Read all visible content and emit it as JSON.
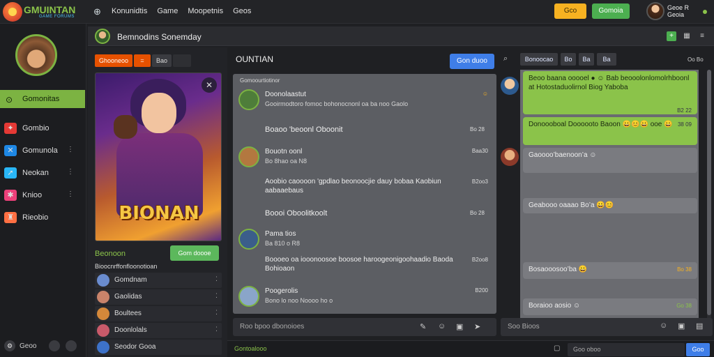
{
  "app": {
    "brand": "GMUINTAN",
    "brand_sub": "GAME FORUMS"
  },
  "topbar": {
    "nav": [
      "Konunidtis",
      "Game",
      "Moopetnis",
      "Geos"
    ],
    "yellow_btn": "Gco",
    "green_btn": "Gomoia",
    "user_line1": "Geoe R",
    "user_line2": "Geoia"
  },
  "sidebar": {
    "active": "Gomonitas",
    "items": [
      {
        "label": "Gombio",
        "icon": "gamepad-icon",
        "color": "#e53935",
        "more": ""
      },
      {
        "label": "Gomunola",
        "icon": "game-icon",
        "color": "#1e88e5",
        "more": "⋮"
      },
      {
        "label": "Neokan",
        "icon": "arrow-icon",
        "color": "#29b6f6",
        "more": "⋮"
      },
      {
        "label": "Knioo",
        "icon": "puzzle-icon",
        "color": "#ec407a",
        "more": "⋮"
      },
      {
        "label": "Rieobio",
        "icon": "trophy-icon",
        "color": "#ff7043",
        "more": ""
      }
    ],
    "bottom_label": "Geoo"
  },
  "channel": {
    "title": "Bemnodins Sonemday"
  },
  "left_pane": {
    "tags": [
      "Ghooneoo",
      "=",
      "Bao"
    ],
    "hero_title": "BIONAN",
    "section_title": "Beonoon",
    "section_button": "Gom doooe",
    "subtitle": "Bioocnrffonfloonotioan",
    "list": [
      {
        "name": "Gomdnam",
        "color": "#6a8ccf"
      },
      {
        "name": "Gaolidas",
        "color": "#c9836a"
      },
      {
        "name": "Boultees",
        "color": "#d4883a"
      },
      {
        "name": "Doonlolals",
        "color": "#c95a6a"
      },
      {
        "name": "Seodor Gooa",
        "color": "#3d72c9"
      }
    ]
  },
  "center": {
    "title": "OUNTIAN",
    "button": "Gon duoo",
    "feed_head": "Gomoourtiotinor",
    "posts": [
      {
        "name": "Doonolaastut",
        "sub": "Gooirmodtoro fomoc bohonocnonl oa ba noo Gaolo",
        "time": "",
        "color": "#4e7d3a"
      },
      {
        "name": "Bouotn oonl",
        "sub": "Bo  8hao  oa  N8",
        "time": "Baa30",
        "color": "#b37840"
      },
      {
        "name": "Pama tios",
        "sub": "Ba  810  o  R8",
        "time": "",
        "color": "#3b5e8a"
      },
      {
        "name": "Poogerolis",
        "sub": "Bono lo noo  Noooo ho o",
        "time": "B200",
        "color": "#8aa5c9"
      }
    ],
    "headings": [
      {
        "text": "Boaoo 'beoonl Oboonit",
        "time": "Bo 28"
      },
      {
        "text": "Boooi Oboolitkoolt",
        "time": "Bo 28"
      }
    ],
    "bodies": [
      {
        "text": "Aoobio caoooon 'gpdlao beonoocjie dauy bobaa Kaobiun aabaaebaus",
        "time": "B2oo3"
      },
      {
        "text": "Boooeo oa iooonoosoe boosoe haroogeonigoohaadio Baoda Bohioaon",
        "time": "B2oo8"
      }
    ],
    "composer_placeholder": "Roo bpoo dbonoioes"
  },
  "right": {
    "tabs": [
      "Bonoocao",
      "Bo",
      "Ba",
      "Ba"
    ],
    "tab_right": "Oo Bo",
    "messages": [
      {
        "text": "Beoo baana ooooel ● ☺  Bab beooolonlomolrhboonl at Hotostaduolirnol  Biog Yaboba",
        "time": "B2 22",
        "style": "green"
      },
      {
        "text": "Donoooboal  Doooooto Baoon 😀😊😀 ooe 😀",
        "time": "38 09",
        "style": "green"
      },
      {
        "text": "Gaoooo’baenoon’a ☺",
        "time": "",
        "style": "gray"
      },
      {
        "text": "Geabooo oaaao Bo’a 😀😊",
        "time": "",
        "style": "gray"
      },
      {
        "text": "Bosaooosoo’ba 😀",
        "time": "Bo 38",
        "style": "gray"
      },
      {
        "text": "Boraioo aosio ☺",
        "time": "Go 38",
        "style": "gray"
      }
    ],
    "search_placeholder": "Soo Bioos"
  },
  "bottom": {
    "label": "Gontoalooo",
    "input_placeholder": "Goo oboo",
    "send": "Goo"
  }
}
